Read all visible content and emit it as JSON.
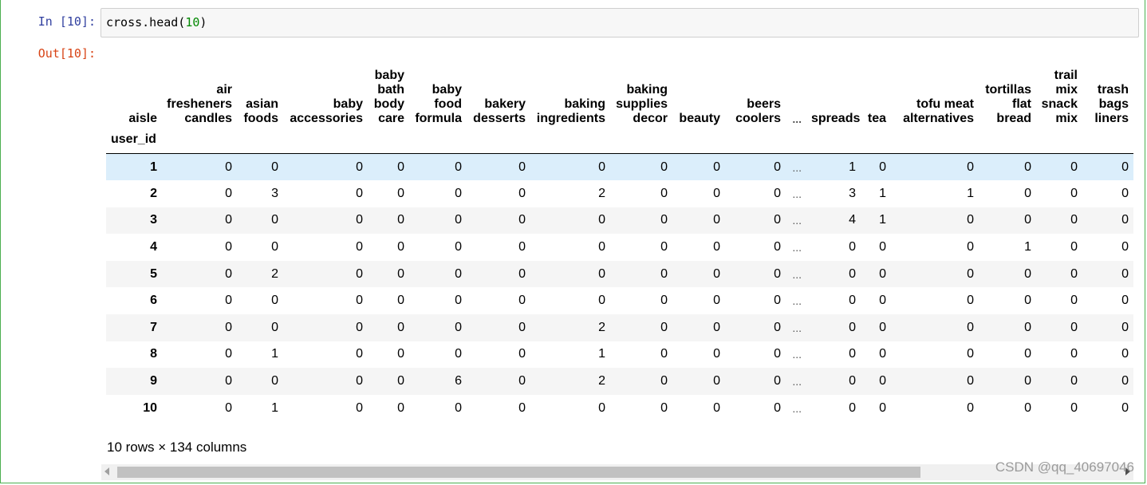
{
  "input_prompt": "In  [10]:",
  "output_prompt": "Out[10]:",
  "code": {
    "prefix": "cross.head(",
    "arg": "10",
    "suffix": ")"
  },
  "table": {
    "columns_name": "aisle",
    "index_name": "user_id",
    "columns": [
      "air fresheners candles",
      "asian foods",
      "baby accessories",
      "baby bath body care",
      "baby food formula",
      "bakery desserts",
      "baking ingredients",
      "baking supplies decor",
      "beauty",
      "beers coolers",
      "...",
      "spreads",
      "tea",
      "tofu meat alternatives",
      "tortillas flat bread",
      "trail mix snack mix",
      "trash bags liners"
    ],
    "rows": [
      {
        "index": "1",
        "values": [
          "0",
          "0",
          "0",
          "0",
          "0",
          "0",
          "0",
          "0",
          "0",
          "0",
          "...",
          "1",
          "0",
          "0",
          "0",
          "0",
          "0"
        ]
      },
      {
        "index": "2",
        "values": [
          "0",
          "3",
          "0",
          "0",
          "0",
          "0",
          "2",
          "0",
          "0",
          "0",
          "...",
          "3",
          "1",
          "1",
          "0",
          "0",
          "0"
        ]
      },
      {
        "index": "3",
        "values": [
          "0",
          "0",
          "0",
          "0",
          "0",
          "0",
          "0",
          "0",
          "0",
          "0",
          "...",
          "4",
          "1",
          "0",
          "0",
          "0",
          "0"
        ]
      },
      {
        "index": "4",
        "values": [
          "0",
          "0",
          "0",
          "0",
          "0",
          "0",
          "0",
          "0",
          "0",
          "0",
          "...",
          "0",
          "0",
          "0",
          "1",
          "0",
          "0"
        ]
      },
      {
        "index": "5",
        "values": [
          "0",
          "2",
          "0",
          "0",
          "0",
          "0",
          "0",
          "0",
          "0",
          "0",
          "...",
          "0",
          "0",
          "0",
          "0",
          "0",
          "0"
        ]
      },
      {
        "index": "6",
        "values": [
          "0",
          "0",
          "0",
          "0",
          "0",
          "0",
          "0",
          "0",
          "0",
          "0",
          "...",
          "0",
          "0",
          "0",
          "0",
          "0",
          "0"
        ]
      },
      {
        "index": "7",
        "values": [
          "0",
          "0",
          "0",
          "0",
          "0",
          "0",
          "2",
          "0",
          "0",
          "0",
          "...",
          "0",
          "0",
          "0",
          "0",
          "0",
          "0"
        ]
      },
      {
        "index": "8",
        "values": [
          "0",
          "1",
          "0",
          "0",
          "0",
          "0",
          "1",
          "0",
          "0",
          "0",
          "...",
          "0",
          "0",
          "0",
          "0",
          "0",
          "0"
        ]
      },
      {
        "index": "9",
        "values": [
          "0",
          "0",
          "0",
          "0",
          "6",
          "0",
          "2",
          "0",
          "0",
          "0",
          "...",
          "0",
          "0",
          "0",
          "0",
          "0",
          "0"
        ]
      },
      {
        "index": "10",
        "values": [
          "0",
          "1",
          "0",
          "0",
          "0",
          "0",
          "0",
          "0",
          "0",
          "0",
          "...",
          "0",
          "0",
          "0",
          "0",
          "0",
          "0"
        ]
      }
    ]
  },
  "summary": "10 rows × 134 columns",
  "watermark": "CSDN @qq_40697046",
  "colors": {
    "cell_border": "#4caf50",
    "prompt_in": "#303f9f",
    "prompt_out": "#d84315",
    "row_highlight": "#dbeefb"
  }
}
